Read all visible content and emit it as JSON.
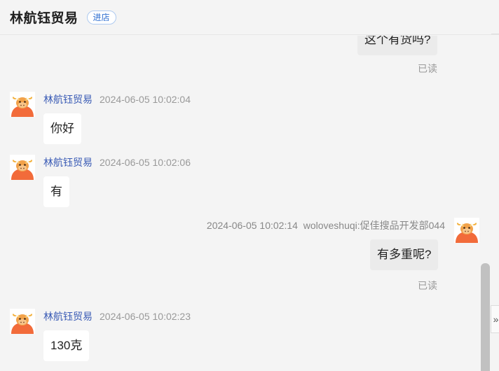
{
  "header": {
    "title": "林航钰贸易",
    "enter_store_label": "进店"
  },
  "messages": [
    {
      "direction": "out",
      "text": "这个有货吗?",
      "status": "已读"
    },
    {
      "direction": "in",
      "sender": "林航钰贸易",
      "time": "2024-06-05 10:02:04",
      "text": "你好"
    },
    {
      "direction": "in",
      "sender": "林航钰贸易",
      "time": "2024-06-05 10:02:06",
      "text": "有"
    },
    {
      "direction": "out",
      "time": "2024-06-05 10:02:14",
      "sender": "woloveshuqi:促佳搜品开发部044",
      "text": "有多重呢?",
      "status": "已读"
    },
    {
      "direction": "in",
      "sender": "林航钰贸易",
      "time": "2024-06-05 10:02:23",
      "text": "130克"
    }
  ],
  "ui": {
    "expand_glyph": "»"
  },
  "colors": {
    "background": "#f4f4f4",
    "sender_link": "#3a5bb5",
    "enter_store_text": "#2f6fd1"
  }
}
